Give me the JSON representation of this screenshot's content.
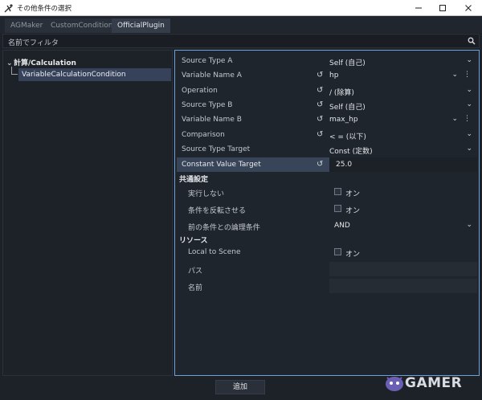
{
  "window": {
    "title": "その他条件の選択"
  },
  "tabs": [
    {
      "label": "AGMaker",
      "active": false
    },
    {
      "label": "CustomCondition",
      "active": false
    },
    {
      "label": "OfficialPlugin",
      "active": true
    }
  ],
  "filter": {
    "placeholder": "名前でフィルタ"
  },
  "tree": {
    "group": "計算/Calculation",
    "items": [
      {
        "label": "VariableCalculationCondition",
        "selected": true
      }
    ]
  },
  "properties": [
    {
      "label": "Source Type A",
      "value": "Self (自己)"
    },
    {
      "label": "Variable Name A",
      "value": "hp"
    },
    {
      "label": "Operation",
      "value": "/ (除算)"
    },
    {
      "label": "Source Type B",
      "value": "Self (自己)"
    },
    {
      "label": "Variable Name B",
      "value": "max_hp"
    },
    {
      "label": "Comparison",
      "value": "< = (以下)"
    },
    {
      "label": "Source Type Target",
      "value": "Const (定数)"
    },
    {
      "label": "Constant Value Target",
      "value": "25.0"
    }
  ],
  "common": {
    "title": "共通設定",
    "not_run": {
      "label": "実行しない",
      "toggle": "オン"
    },
    "invert": {
      "label": "条件を反転させる",
      "toggle": "オン"
    },
    "logic": {
      "label": "前の条件との論理条件",
      "value": "AND"
    }
  },
  "resources": {
    "title": "リソース",
    "local": {
      "label": "Local to Scene",
      "toggle": "オン"
    },
    "path": {
      "label": "パス",
      "value": ""
    },
    "name": {
      "label": "名前",
      "value": ""
    }
  },
  "footer": {
    "add_label": "追加"
  },
  "watermark": {
    "text": "GAMER"
  },
  "colors": {
    "accent_border": "#6ea0d8",
    "selection": "#36415a",
    "background": "#1d2229"
  }
}
